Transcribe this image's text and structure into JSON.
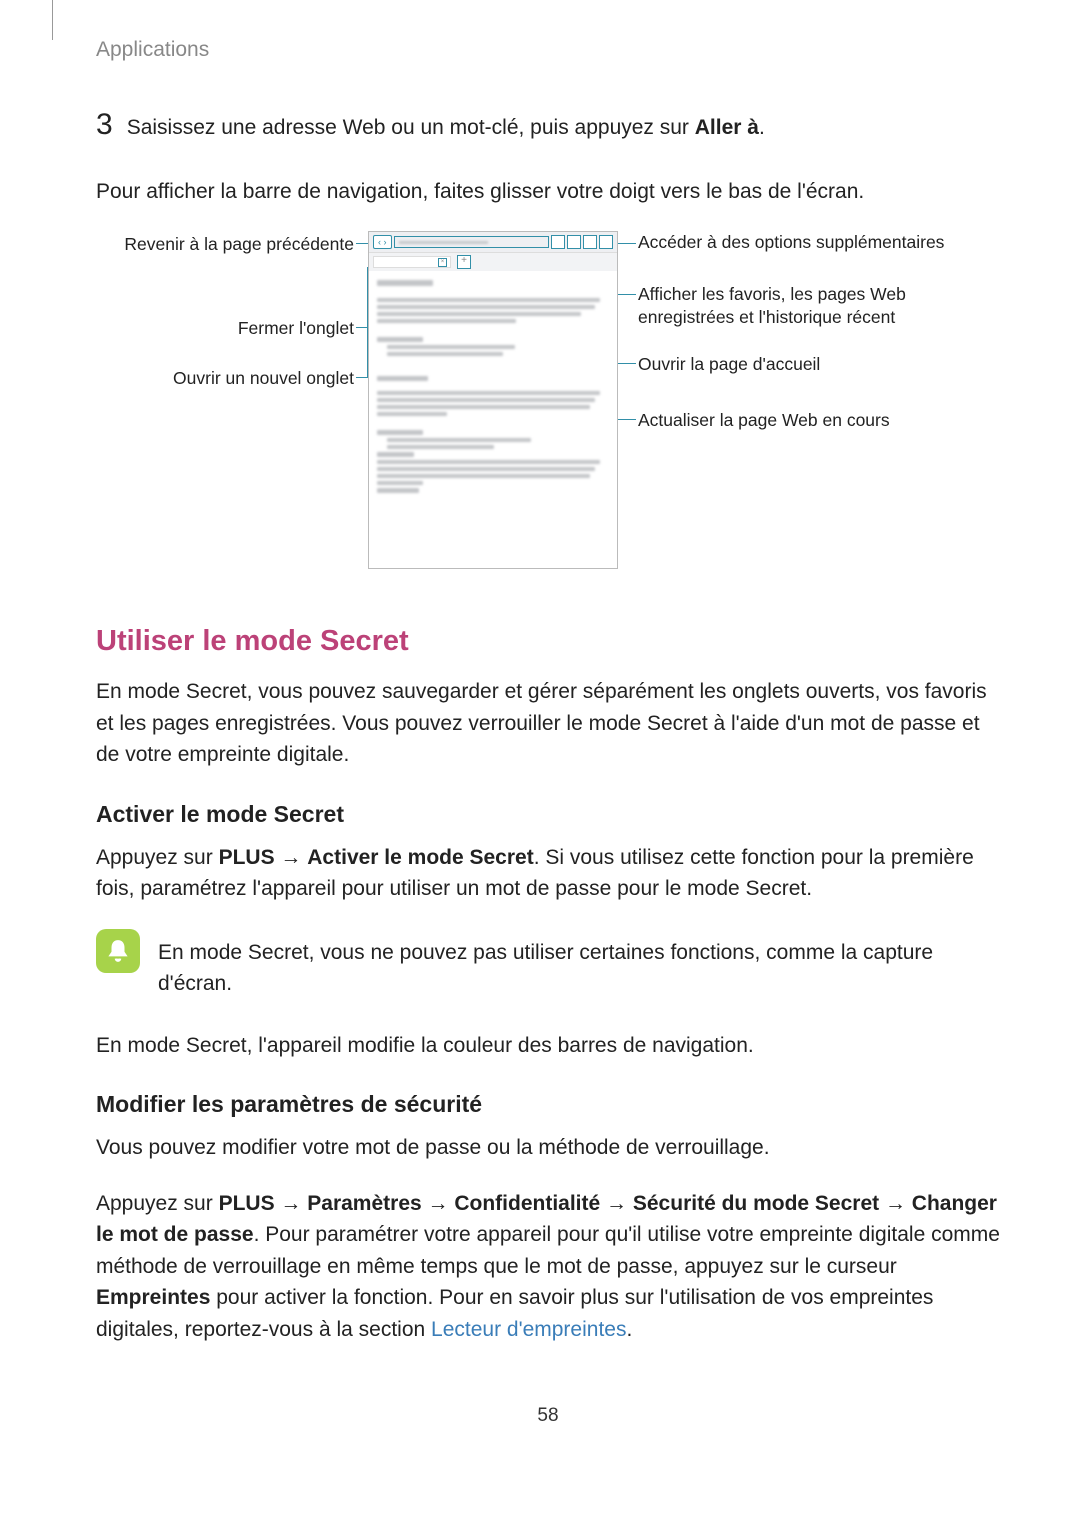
{
  "header": "Applications",
  "step_number": "3",
  "step_text_prefix": "Saisissez une adresse Web ou un mot-clé, puis appuyez sur ",
  "step_text_bold": "Aller à",
  "step_text_suffix": ".",
  "intro_nav": "Pour afficher la barre de navigation, faites glisser votre doigt vers le bas de l'écran.",
  "callouts": {
    "prev_page": "Revenir à la page précédente",
    "close_tab": "Fermer l'onglet",
    "new_tab": "Ouvrir un nouvel onglet",
    "more_options": "Accéder à des options supplémentaires",
    "bookmarks": "Afficher les favoris, les pages Web enregistrées et l'historique récent",
    "home_page": "Ouvrir la page d'accueil",
    "refresh": "Actualiser la page Web en cours"
  },
  "secret_mode": {
    "title": "Utiliser le mode Secret",
    "desc": "En mode Secret, vous pouvez sauvegarder et gérer séparément les onglets ouverts, vos favoris et les pages enregistrées. Vous pouvez verrouiller le mode Secret à l'aide d'un mot de passe et de votre empreinte digitale."
  },
  "activate": {
    "title": "Activer le mode Secret",
    "p1_prefix": "Appuyez sur ",
    "p1_b1": "PLUS",
    "p1_arrow": " → ",
    "p1_b2": "Activer le mode Secret",
    "p1_suffix": ". Si vous utilisez cette fonction pour la première fois, paramétrez l'appareil pour utiliser un mot de passe pour le mode Secret.",
    "note": "En mode Secret, vous ne pouvez pas utiliser certaines fonctions, comme la capture d'écran.",
    "p2": "En mode Secret, l'appareil modifie la couleur des barres de navigation."
  },
  "security": {
    "title": "Modifier les paramètres de sécurité",
    "p1": "Vous pouvez modifier votre mot de passe ou la méthode de verrouillage.",
    "p2_prefix": "Appuyez sur ",
    "p2_b1": "PLUS",
    "p2_b2": "Paramètres",
    "p2_b3": "Confidentialité",
    "p2_b4": "Sécurité du mode Secret",
    "p2_b5": "Changer le mot de passe",
    "p2_mid": ". Pour paramétrer votre appareil pour qu'il utilise votre empreinte digitale comme méthode de verrouillage en même temps que le mot de passe, appuyez sur le curseur ",
    "p2_b6": "Empreintes",
    "p2_suffix": " pour activer la fonction. Pour en savoir plus sur l'utilisation de vos empreintes digitales, reportez-vous à la section ",
    "p2_link": "Lecteur d'empreintes",
    "p2_end": "."
  },
  "arrow_sep": " → ",
  "page_number": "58"
}
